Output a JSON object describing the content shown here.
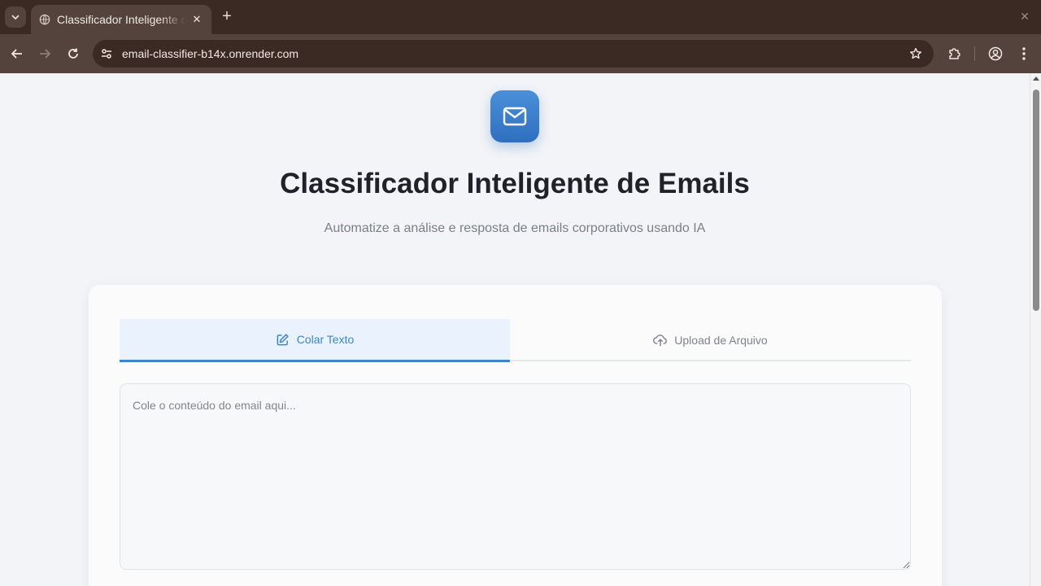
{
  "browser": {
    "tab_title": "Classificador Inteligente de Emails",
    "url": "email-classifier-b14x.onrender.com"
  },
  "page": {
    "title": "Classificador Inteligente de Emails",
    "subtitle": "Automatize a análise e resposta de emails corporativos usando IA",
    "tabs": [
      {
        "label": "Colar Texto",
        "icon": "edit-icon",
        "active": true
      },
      {
        "label": "Upload de Arquivo",
        "icon": "upload-cloud-icon",
        "active": false
      }
    ],
    "email_input": {
      "placeholder": "Cole o conteúdo do email aqui...",
      "value": ""
    }
  },
  "colors": {
    "accent": "#3a86d0",
    "logo_gradient_top": "#4a90d9",
    "logo_gradient_bottom": "#2f6fc0",
    "chrome_dark": "#3b2a24",
    "chrome_mid": "#54433c"
  }
}
